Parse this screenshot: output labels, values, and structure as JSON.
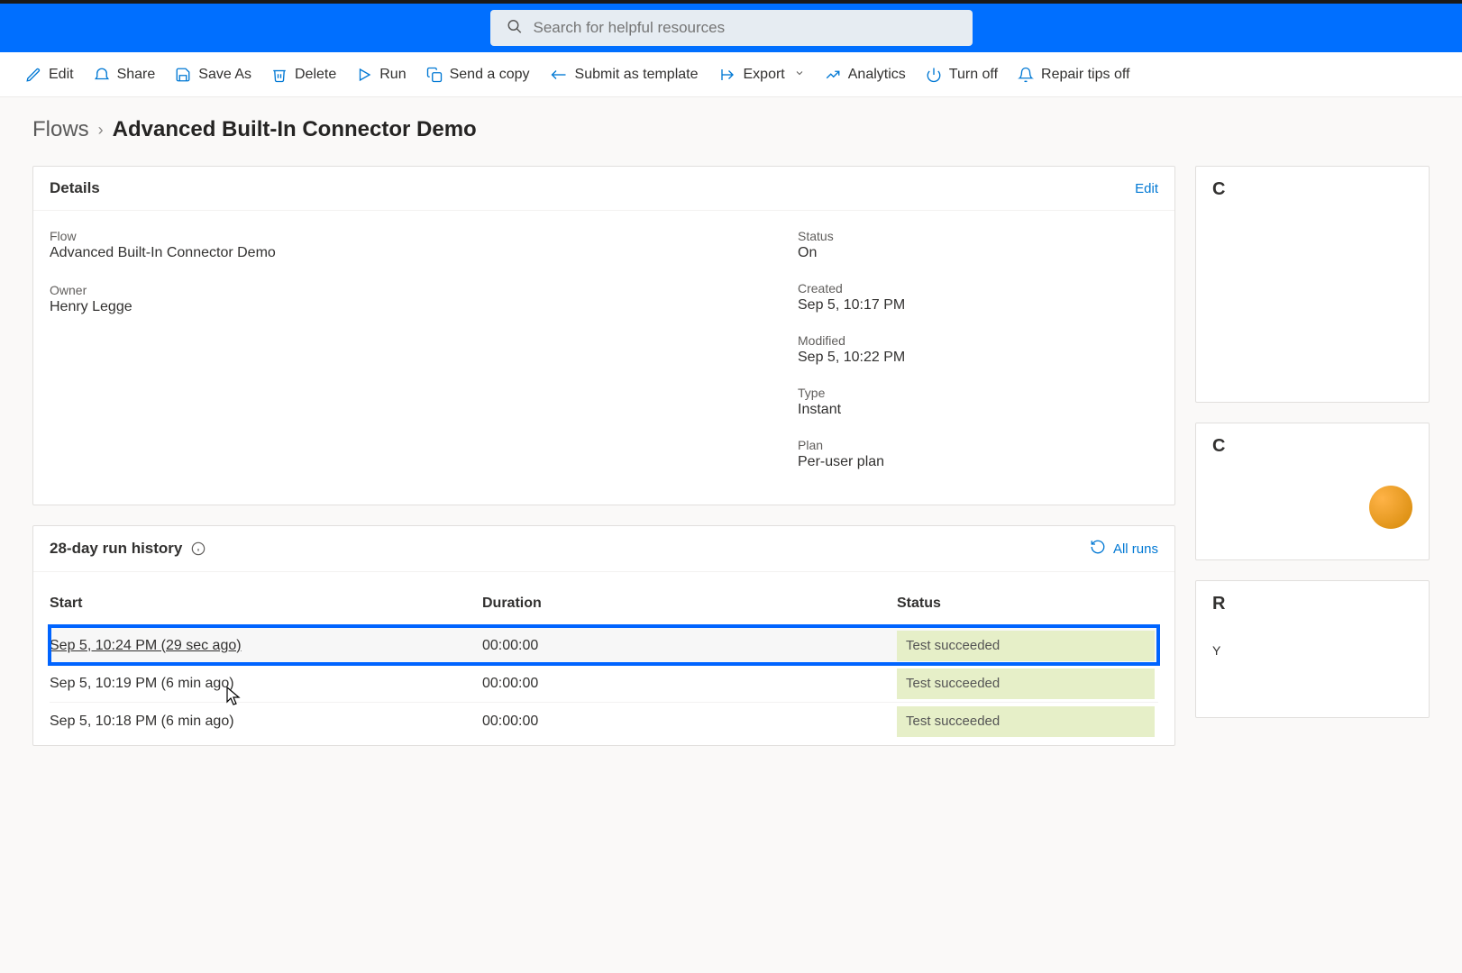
{
  "search": {
    "placeholder": "Search for helpful resources"
  },
  "toolbar": {
    "edit": "Edit",
    "share": "Share",
    "save_as": "Save As",
    "delete": "Delete",
    "run": "Run",
    "send_copy": "Send a copy",
    "submit_template": "Submit as template",
    "export": "Export",
    "analytics": "Analytics",
    "turn_off": "Turn off",
    "repair_tips_off": "Repair tips off"
  },
  "breadcrumb": {
    "root": "Flows",
    "sep": "›",
    "current": "Advanced Built-In Connector Demo"
  },
  "details": {
    "card_title": "Details",
    "edit_action": "Edit",
    "flow_label": "Flow",
    "flow_value": "Advanced Built-In Connector Demo",
    "owner_label": "Owner",
    "owner_value": "Henry Legge",
    "status_label": "Status",
    "status_value": "On",
    "created_label": "Created",
    "created_value": "Sep 5, 10:17 PM",
    "modified_label": "Modified",
    "modified_value": "Sep 5, 10:22 PM",
    "type_label": "Type",
    "type_value": "Instant",
    "plan_label": "Plan",
    "plan_value": "Per-user plan"
  },
  "history": {
    "title": "28-day run history",
    "all_runs": "All runs",
    "columns": {
      "start": "Start",
      "duration": "Duration",
      "status": "Status"
    },
    "rows": [
      {
        "start": "Sep 5, 10:24 PM (29 sec ago)",
        "duration": "00:00:00",
        "status": "Test succeeded",
        "selected": true
      },
      {
        "start": "Sep 5, 10:19 PM (6 min ago)",
        "duration": "00:00:00",
        "status": "Test succeeded",
        "selected": false
      },
      {
        "start": "Sep 5, 10:18 PM (6 min ago)",
        "duration": "00:00:00",
        "status": "Test succeeded",
        "selected": false
      }
    ]
  },
  "side": {
    "panel1_letter": "C",
    "panel2_letter": "C",
    "panel3_letter": "R",
    "panel3_sub": "Y"
  }
}
